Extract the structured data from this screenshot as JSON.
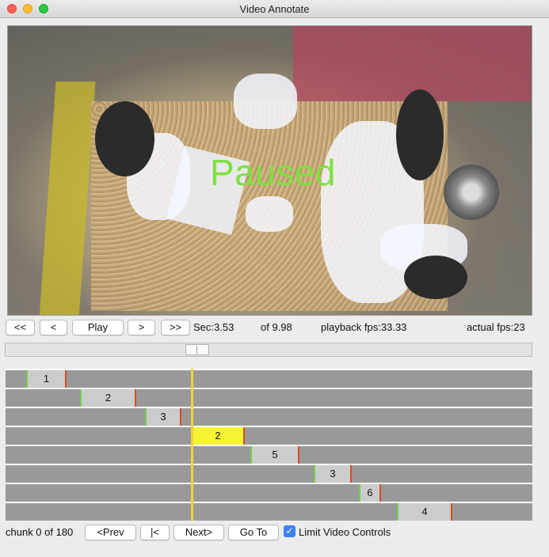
{
  "window": {
    "title": "Video Annotate"
  },
  "video": {
    "overlay_text": "Paused",
    "overlay_color": "#7fe041"
  },
  "controls": {
    "back_fast_label": "<<",
    "back_label": "<",
    "play_label": "Play",
    "forward_label": ">",
    "forward_fast_label": ">>",
    "sec_text": "Sec:3.53",
    "of_text": "of 9.98",
    "playback_fps_text": "playback fps:33.33",
    "actual_fps_text": "actual fps:23"
  },
  "scrubber": {
    "position_fraction": 0.36
  },
  "timeline": {
    "track_color": "#999999",
    "segment_color": "#cccccc",
    "active_color": "#f4f430",
    "segments": [
      {
        "track": 0,
        "label": "1",
        "active": false
      },
      {
        "track": 1,
        "label": "2",
        "active": false
      },
      {
        "track": 2,
        "label": "3",
        "active": false
      },
      {
        "track": 3,
        "label": "2",
        "active": true
      },
      {
        "track": 4,
        "label": "5",
        "active": false
      },
      {
        "track": 5,
        "label": "3",
        "active": false
      },
      {
        "track": 6,
        "label": "6",
        "active": false
      },
      {
        "track": 7,
        "label": "4",
        "active": false
      }
    ]
  },
  "footer": {
    "chunk_text": "chunk 0 of 180",
    "prev_label": "<Prev",
    "start_label": "|<",
    "next_label": "Next>",
    "goto_label": "Go To",
    "limit_label": "Limit Video Controls",
    "limit_checked": true
  }
}
